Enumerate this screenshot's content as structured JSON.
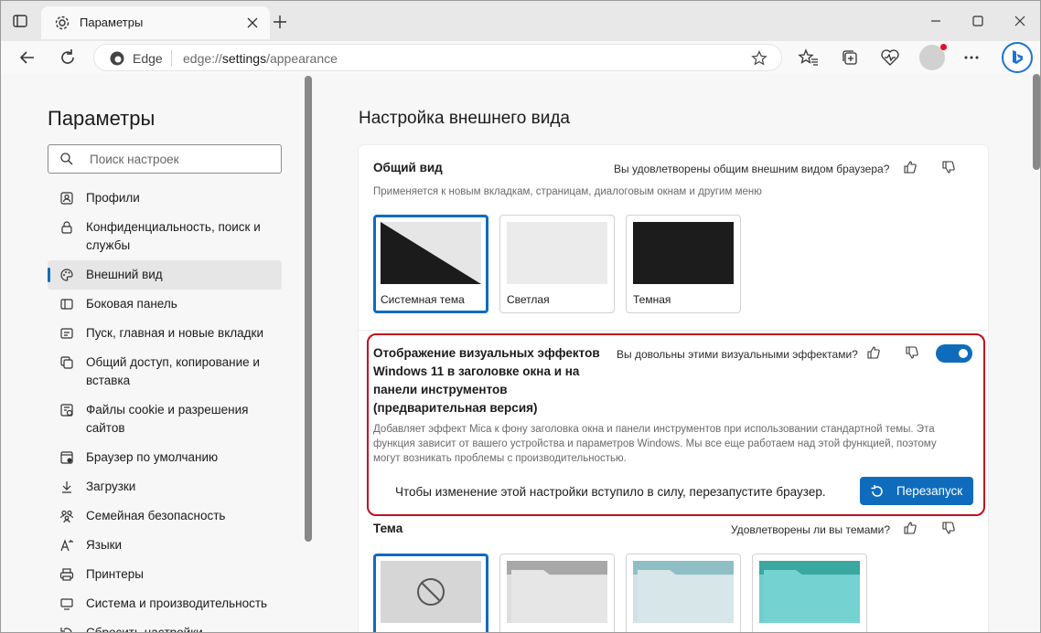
{
  "tab": {
    "title": "Параметры"
  },
  "address": {
    "site": "Edge",
    "url_prefix": "edge://",
    "url_main": "settings",
    "url_suffix": "/appearance"
  },
  "sidebar": {
    "title": "Параметры",
    "search_placeholder": "Поиск настроек",
    "items": [
      {
        "label": "Профили",
        "icon": "profile-icon"
      },
      {
        "label": "Конфиденциальность, поиск и службы",
        "icon": "lock-icon"
      },
      {
        "label": "Внешний вид",
        "icon": "palette-icon",
        "active": true
      },
      {
        "label": "Боковая панель",
        "icon": "sidebar-icon"
      },
      {
        "label": "Пуск, главная и новые вкладки",
        "icon": "home-icon"
      },
      {
        "label": "Общий доступ, копирование и вставка",
        "icon": "share-icon"
      },
      {
        "label": "Файлы cookie и разрешения сайтов",
        "icon": "cookie-icon"
      },
      {
        "label": "Браузер по умолчанию",
        "icon": "browser-icon"
      },
      {
        "label": "Загрузки",
        "icon": "download-icon"
      },
      {
        "label": "Семейная безопасность",
        "icon": "family-icon"
      },
      {
        "label": "Языки",
        "icon": "language-icon"
      },
      {
        "label": "Принтеры",
        "icon": "printer-icon"
      },
      {
        "label": "Система и производительность",
        "icon": "system-icon"
      },
      {
        "label": "Сбросить настройки",
        "icon": "reset-icon"
      }
    ]
  },
  "main": {
    "title": "Настройка внешнего вида",
    "general": {
      "title": "Общий вид",
      "feedback": "Вы удовлетворены общим внешним видом браузера?",
      "description": "Применяется к новым вкладкам, страницам, диалоговым окнам и другим меню",
      "options": [
        {
          "label": "Системная тема",
          "selected": true
        },
        {
          "label": "Светлая",
          "selected": false
        },
        {
          "label": "Темная",
          "selected": false
        }
      ]
    },
    "mica": {
      "title_l1": "Отображение визуальных эффектов",
      "title_l2": "Windows 11 в заголовке окна и на",
      "title_l3": "панели инструментов",
      "title_l4": "(предварительная версия)",
      "feedback": "Вы довольны этими визуальными эффектами?",
      "desc_l1": "Добавляет эффект Mica к фону заголовка окна и панели инструментов при использовании стандартной темы. Эта",
      "desc_l2": "функция зависит от вашего устройства и параметров Windows. Мы все еще работаем над этой функцией, поэтому",
      "desc_l3": "могут возникать проблемы с производительностью.",
      "enabled": true,
      "restart_note": "Чтобы изменение этой настройки вступило в силу, перезапустите браузер.",
      "restart_button": "Перезапуск"
    },
    "theme": {
      "title": "Тема",
      "feedback": "Удовлетворены ли вы темами?"
    }
  },
  "colors": {
    "accent": "#0f6cbd",
    "highlight": "#c40d1e"
  }
}
